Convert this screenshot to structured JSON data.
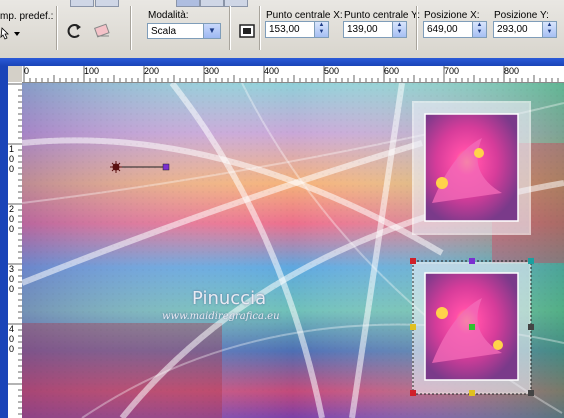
{
  "toolbar": {
    "preset_label": "mp. predef.:",
    "mode_label": "Modalità:",
    "mode_value": "Scala",
    "center_x_label": "Punto centrale X:",
    "center_x_value": "153,00",
    "center_y_label": "Punto centrale Y:",
    "center_y_value": "139,00",
    "pos_x_label": "Posizione X:",
    "pos_x_value": "649,00",
    "pos_y_label": "Posizione Y:",
    "pos_y_value": "293,00"
  },
  "ruler_h": [
    "0",
    "100",
    "200",
    "300",
    "400",
    "500",
    "600",
    "700",
    "800"
  ],
  "ruler_v": [
    "1",
    "0",
    "0",
    "2",
    "0",
    "0",
    "3",
    "0",
    "0",
    "4",
    "0",
    "0"
  ],
  "watermark": {
    "name": "Pinuccia",
    "url": "www.maidiregrafica.eu"
  },
  "colors": {
    "accent": "#1a44b8",
    "handle_red": "#d0202a",
    "handle_teal": "#1aa0a0",
    "handle_yellow": "#e0c020",
    "handle_purple": "#7b2fd0"
  }
}
